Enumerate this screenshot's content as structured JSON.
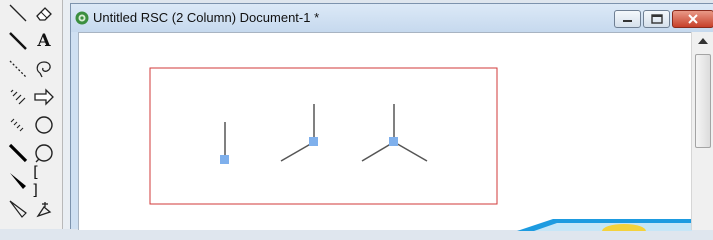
{
  "window": {
    "title": "Untitled RSC (2 Column) Document-1 *"
  },
  "tools": [
    {
      "name": "line-tool-icon"
    },
    {
      "name": "eraser-tool-icon"
    },
    {
      "name": "bond-tool-icon"
    },
    {
      "name": "text-tool-icon",
      "label": "A"
    },
    {
      "name": "dashed-bond-tool-icon"
    },
    {
      "name": "lasso-tool-icon"
    },
    {
      "name": "hashed-wedge-tool-icon"
    },
    {
      "name": "arrow-tool-icon"
    },
    {
      "name": "hashed-bond-tool-icon"
    },
    {
      "name": "orbital-tool-icon"
    },
    {
      "name": "bold-bond-tool-icon"
    },
    {
      "name": "circle-tool-icon"
    },
    {
      "name": "wedge-bond-tool-icon"
    },
    {
      "name": "bracket-tool-icon",
      "label": "[ ]"
    },
    {
      "name": "wedge-hash-tool-icon"
    },
    {
      "name": "atom-map-tool-icon"
    }
  ],
  "colors": {
    "selection_box": "#d23a3a",
    "node_highlight": "#7fb0ec",
    "bond": "#555555",
    "accent_arrow": "#1d9be0"
  }
}
